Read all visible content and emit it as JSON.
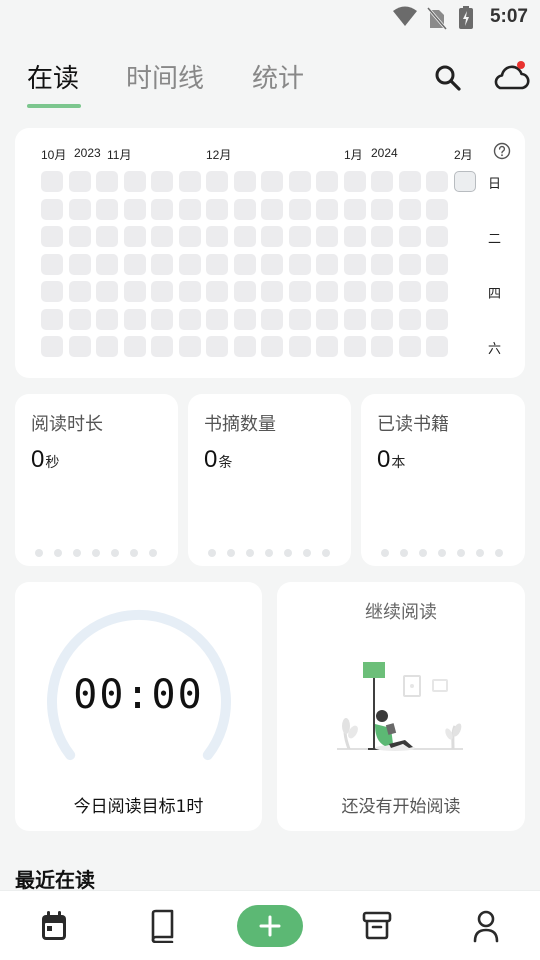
{
  "status_bar": {
    "time": "5:07",
    "icons": [
      "wifi-icon",
      "no-sim-icon",
      "battery-charging-icon"
    ]
  },
  "tabs": [
    {
      "label": "在读",
      "active": true
    },
    {
      "label": "时间线",
      "active": false
    },
    {
      "label": "统计",
      "active": false
    }
  ],
  "header_icons": [
    "search-icon",
    "cloud-sync-icon"
  ],
  "heatmap": {
    "months": [
      "10月",
      "2023",
      "11月",
      "12月",
      "1月",
      "2024",
      "2月"
    ],
    "weekdays": [
      "日",
      "二",
      "四",
      "六"
    ],
    "help_icon": "help-circle-icon"
  },
  "stats": [
    {
      "label": "阅读时长",
      "value": "0",
      "unit": "秒"
    },
    {
      "label": "书摘数量",
      "value": "0",
      "unit": "条"
    },
    {
      "label": "已读书籍",
      "value": "0",
      "unit": "本"
    }
  ],
  "timer": {
    "display": "00:00",
    "goal": "今日阅读目标1时"
  },
  "continue_reading": {
    "title": "继续阅读",
    "empty_text": "还没有开始阅读"
  },
  "recent": {
    "title": "最近在读"
  },
  "bottom_nav": [
    "calendar-icon",
    "book-icon",
    "add-icon",
    "archive-icon",
    "person-icon"
  ],
  "colors": {
    "accent": "#5cb874",
    "accent_light": "#7cc68e",
    "badge": "#e8322f",
    "ring": "#e6eef6"
  }
}
